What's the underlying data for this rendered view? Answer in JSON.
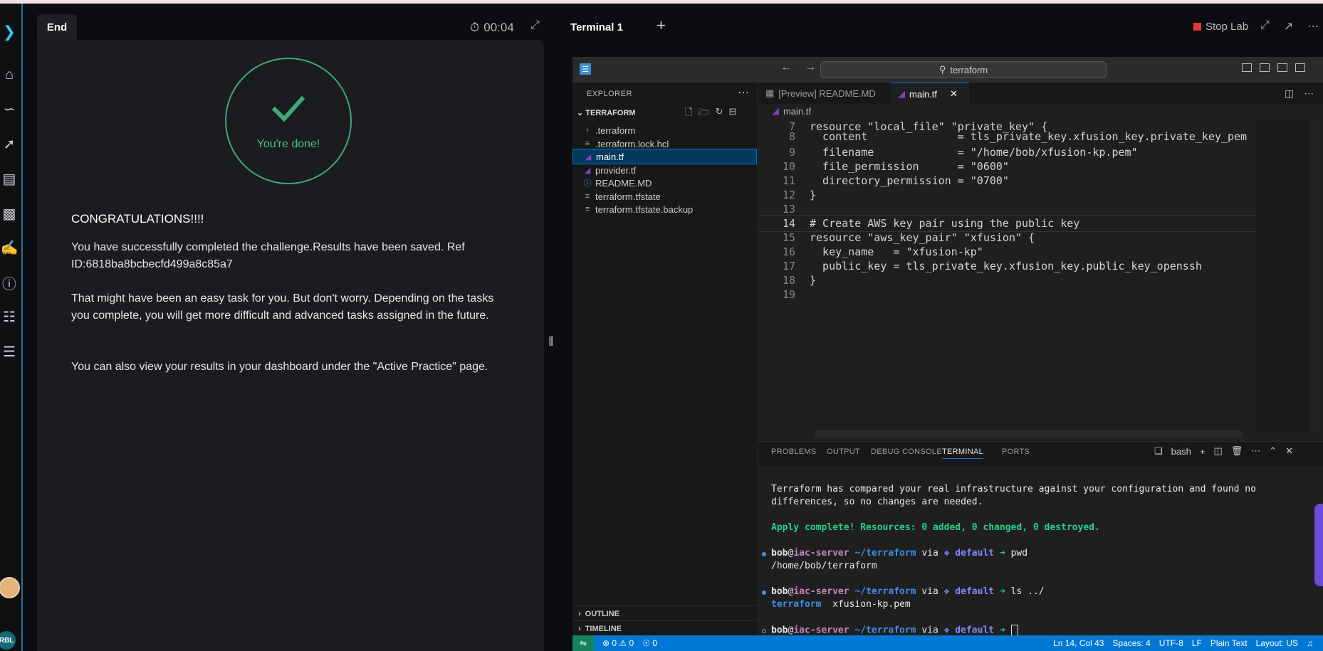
{
  "left_panel": {
    "tab_label": "End",
    "timer": "00:04",
    "done_text": "You're done!",
    "heading": "CONGRATULATIONS!!!!",
    "paragraph1": "You have successfully completed the challenge.Results have been saved. Ref ID:6818ba8bcbecfd499a8c85a7",
    "paragraph2": "That might have been an easy task for you. But don't worry. Depending on the tasks you complete, you will get more difficult and advanced tasks assigned in the future.",
    "paragraph3": "You can also view your results in your dashboard under the \"Active Practice\" page."
  },
  "rail": {
    "badge": "RBL",
    "icons": [
      "logo-icon",
      "home-icon",
      "route-icon",
      "chart-icon",
      "film-icon",
      "podium-icon",
      "chat-icon",
      "info-icon",
      "book-icon",
      "forum-icon"
    ]
  },
  "right_panel": {
    "tab_label": "Terminal 1",
    "add_label": "+",
    "stop_label": "Stop Lab"
  },
  "vscode": {
    "search_text": "terraform",
    "explorer_title": "EXPLORER",
    "folder": "TERRAFORM",
    "files": [
      {
        "name": ".terraform",
        "icon": "chevron-right-icon"
      },
      {
        "name": ".terraform.lock.hcl",
        "icon": "lines-icon"
      },
      {
        "name": "main.tf",
        "icon": "terraform-icon"
      },
      {
        "name": "provider.tf",
        "icon": "terraform-icon"
      },
      {
        "name": "README.MD",
        "icon": "info-icon"
      },
      {
        "name": "terraform.tfstate",
        "icon": "lines-icon"
      },
      {
        "name": "terraform.tfstate.backup",
        "icon": "lines-icon"
      }
    ],
    "outline": "OUTLINE",
    "timeline": "TIMELINE",
    "tabs": [
      {
        "label": "[Preview] README.MD",
        "active": false
      },
      {
        "label": "main.tf",
        "active": true
      }
    ],
    "breadcrumb": "main.tf",
    "code_lines": [
      {
        "n": "7",
        "text": "resource \"local_file\" \"private_key\" {"
      },
      {
        "n": "8",
        "text": "  content              = tls_private_key.xfusion_key.private_key_pem"
      },
      {
        "n": "9",
        "text": "  filename             = \"/home/bob/xfusion-kp.pem\""
      },
      {
        "n": "10",
        "text": "  file_permission      = \"0600\""
      },
      {
        "n": "11",
        "text": "  directory_permission = \"0700\""
      },
      {
        "n": "12",
        "text": "}"
      },
      {
        "n": "13",
        "text": ""
      },
      {
        "n": "14",
        "text": "# Create AWS key pair using the public key"
      },
      {
        "n": "15",
        "text": "resource \"aws_key_pair\" \"xfusion\" {"
      },
      {
        "n": "16",
        "text": "  key_name   = \"xfusion-kp\""
      },
      {
        "n": "17",
        "text": "  public_key = tls_private_key.xfusion_key.public_key_openssh"
      },
      {
        "n": "18",
        "text": "}"
      },
      {
        "n": "19",
        "text": ""
      }
    ],
    "panel_tabs": [
      "PROBLEMS",
      "OUTPUT",
      "DEBUG CONSOLE",
      "TERMINAL",
      "PORTS"
    ],
    "shell": "bash",
    "terminal": {
      "line1": "Terraform has compared your real infrastructure against your configuration and found no",
      "line2": "differences, so no changes are needed.",
      "apply": "Apply complete! Resources: 0 added, 0 changed, 0 destroyed.",
      "prompt_user": "bob",
      "prompt_at": "@",
      "prompt_host": "iac-server",
      "prompt_path": " ~/terraform",
      "prompt_via": " via ",
      "prompt_git": "❖ default",
      "prompt_arrow": " ➜ ",
      "cmd1": "pwd",
      "out1": "/home/bob/terraform",
      "cmd2": "ls ../",
      "out2_dir": "terraform",
      "out2_file": "  xfusion-kp.pem"
    },
    "status": {
      "errors": "⊗ 0 ⚠ 0",
      "ports": "0",
      "position": "Ln 14, Col 43",
      "spaces": "Spaces: 4",
      "encoding": "UTF-8",
      "eol": "LF",
      "language": "Plain Text",
      "layout": "Layout: US"
    }
  }
}
